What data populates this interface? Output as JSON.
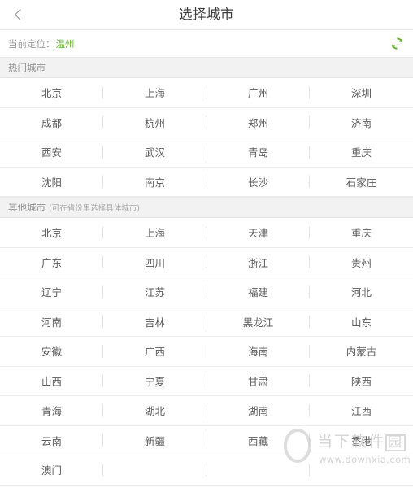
{
  "titlebar": {
    "back_icon": "chevron-left-icon",
    "title": "选择城市"
  },
  "locate": {
    "label": "当前定位：",
    "city": "温州",
    "refresh_icon": "refresh-icon",
    "accent_color": "#63b32e"
  },
  "hot_section": {
    "title": "热门城市",
    "note": "",
    "rows": [
      [
        "北京",
        "上海",
        "广州",
        "深圳"
      ],
      [
        "成都",
        "杭州",
        "郑州",
        "济南"
      ],
      [
        "西安",
        "武汉",
        "青岛",
        "重庆"
      ],
      [
        "沈阳",
        "南京",
        "长沙",
        "石家庄"
      ]
    ]
  },
  "other_section": {
    "title": "其他城市",
    "note": "(可在省份里选择具体城市)",
    "rows": [
      [
        "北京",
        "上海",
        "天津",
        "重庆"
      ],
      [
        "广东",
        "四川",
        "浙江",
        "贵州"
      ],
      [
        "辽宁",
        "江苏",
        "福建",
        "河北"
      ],
      [
        "河南",
        "吉林",
        "黑龙江",
        "山东"
      ],
      [
        "安徽",
        "广西",
        "海南",
        "内蒙古"
      ],
      [
        "山西",
        "宁夏",
        "甘肃",
        "陕西"
      ],
      [
        "青海",
        "湖北",
        "湖南",
        "江西"
      ],
      [
        "云南",
        "新疆",
        "西藏",
        "香港"
      ],
      [
        "澳门",
        "",
        "",
        ""
      ]
    ]
  },
  "watermark": {
    "brand": "当下软件",
    "brand_box": "园",
    "url": "www.downxia.com"
  }
}
